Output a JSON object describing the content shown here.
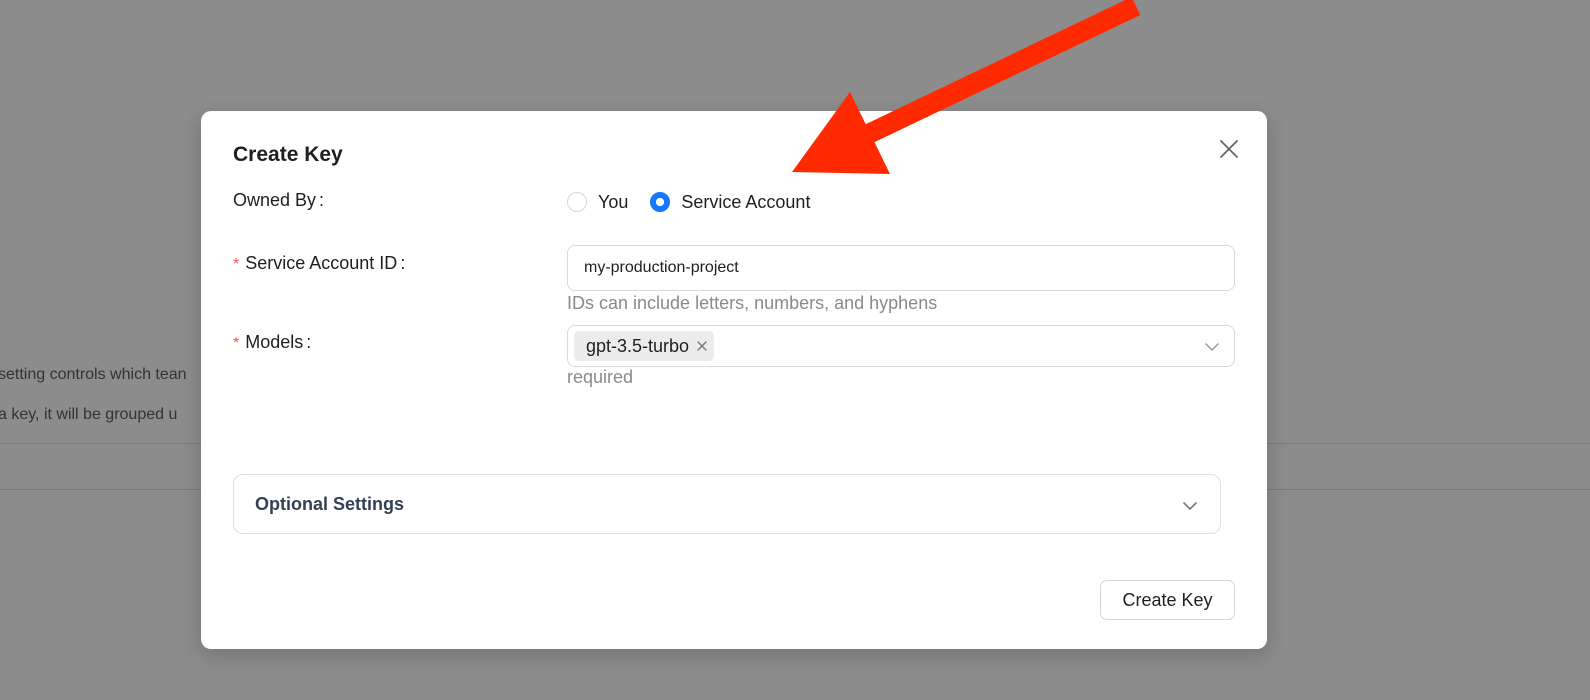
{
  "background": {
    "line1": "setting controls which tean",
    "line2": "a key, it will be grouped u"
  },
  "modal": {
    "title": "Create Key",
    "close_icon": "close-icon",
    "owned_by": {
      "label": "Owned By",
      "options": [
        "You",
        "Service Account"
      ],
      "selected": "Service Account"
    },
    "service_account_id": {
      "required_mark": "*",
      "label": "Service Account ID",
      "value": "my-production-project",
      "help": "IDs can include letters, numbers, and hyphens"
    },
    "models": {
      "required_mark": "*",
      "label": "Models",
      "tags": [
        "gpt-3.5-turbo"
      ],
      "help": "required",
      "arrow_icon": "chevron-down-icon"
    },
    "optional_settings": {
      "label": "Optional Settings",
      "arrow_icon": "chevron-down-icon"
    },
    "submit_label": "Create Key"
  },
  "annotation": {
    "arrow_color": "#ff2a00"
  },
  "colors": {
    "primary": "#1677ff",
    "required": "#ff4d4f",
    "overlay": "#8c8c8c"
  }
}
